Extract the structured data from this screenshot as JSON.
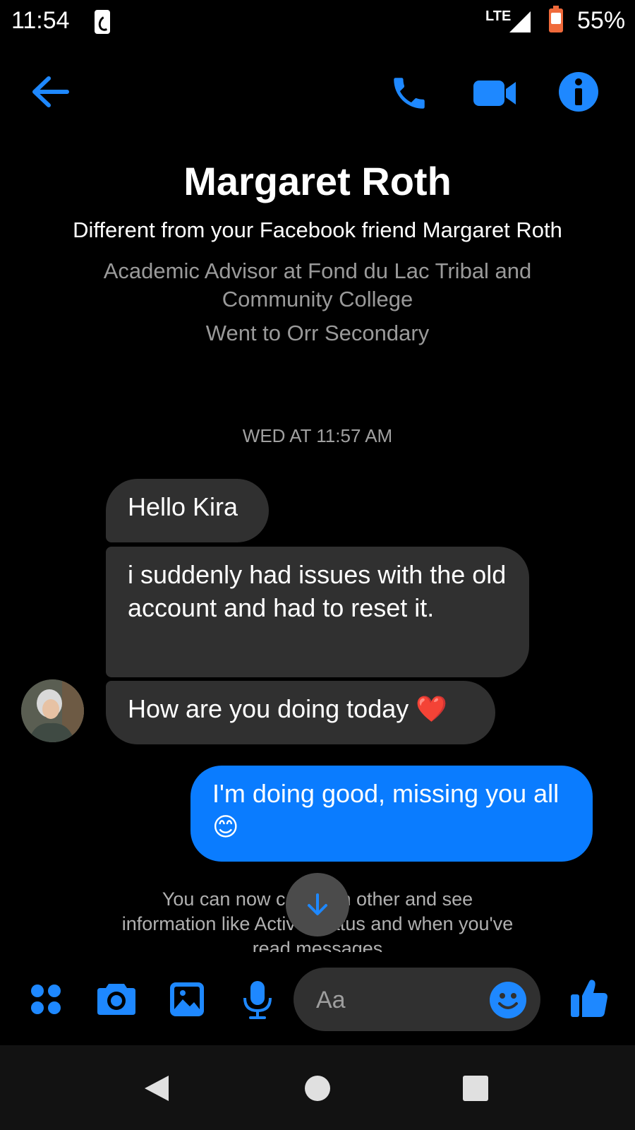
{
  "status_bar": {
    "time": "11:54",
    "network": "LTE",
    "battery": "55%"
  },
  "profile": {
    "name": "Margaret Roth",
    "note": "Different from your Facebook friend Margaret Roth",
    "job": "Academic Advisor at Fond du Lac Tribal and Community College",
    "school": "Went to Orr Secondary"
  },
  "conversation": {
    "timestamp": "WED AT 11:57 AM",
    "messages": [
      {
        "text": "Hello Kira"
      },
      {
        "text": "i suddenly had issues with the old account and had to reset it."
      },
      {
        "text": "How are you doing today ❤️"
      },
      {
        "text": "I'm doing good, missing you all 😊"
      }
    ],
    "system_notice": "You can now call each other and see information like Active Status and when you've read messages"
  },
  "composer": {
    "placeholder": "Aa"
  },
  "colors": {
    "accent": "#0a7cff",
    "icon": "#1e88ff",
    "bubble_in": "#303030"
  },
  "icons": [
    "back-arrow-icon",
    "phone-icon",
    "video-icon",
    "info-icon",
    "apps-icon",
    "camera-icon",
    "gallery-icon",
    "microphone-icon",
    "emoji-icon",
    "thumbs-up-icon"
  ]
}
